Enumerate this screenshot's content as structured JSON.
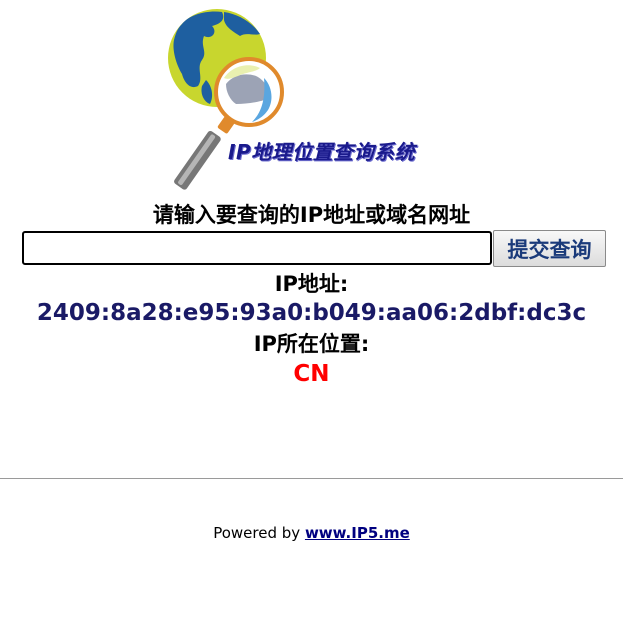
{
  "logo": {
    "title": "IP地理位置查询系统"
  },
  "form": {
    "prompt": "请输入要查询的IP地址或域名网址",
    "query_value": "",
    "submit_label": "提交查询"
  },
  "result": {
    "ip_label": "IP地址:",
    "ip_value": "2409:8a28:e95:93a0:b049:aa06:2dbf:dc3c",
    "location_label": "IP所在位置:",
    "location_value": "CN"
  },
  "footer": {
    "prefix": "Powered by ",
    "link_text": "www.IP5.me"
  },
  "colors": {
    "ip_value": "#1a1a66",
    "location_value": "#ff0000",
    "link": "#000080",
    "logo_text": "#1a1a8c"
  },
  "icons": [
    "globe-magnifier-logo-icon"
  ]
}
